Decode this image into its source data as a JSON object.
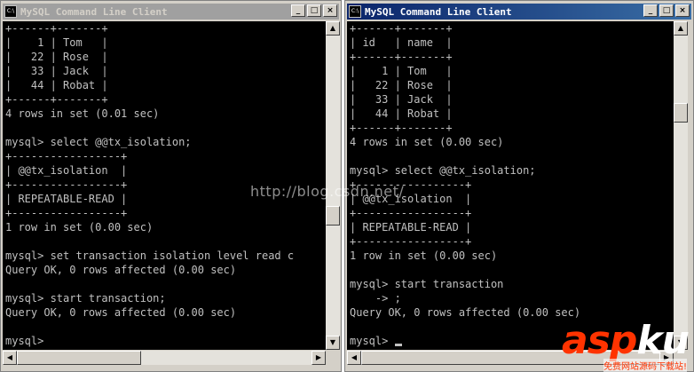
{
  "window_left": {
    "title": "MySQL Command Line Client",
    "console_lines": [
      "+------+-------+",
      "|    1 | Tom   |",
      "|   22 | Rose  |",
      "|   33 | Jack  |",
      "|   44 | Robat |",
      "+------+-------+",
      "4 rows in set (0.01 sec)",
      "",
      "mysql> select @@tx_isolation;",
      "+-----------------+",
      "| @@tx_isolation  |",
      "+-----------------+",
      "| REPEATABLE-READ |",
      "+-----------------+",
      "1 row in set (0.00 sec)",
      "",
      "mysql> set transaction isolation level read c",
      "Query OK, 0 rows affected (0.00 sec)",
      "",
      "mysql> start transaction;",
      "Query OK, 0 rows affected (0.00 sec)",
      "",
      "mysql>"
    ]
  },
  "window_right": {
    "title": "MySQL Command Line Client",
    "console_lines": [
      "+------+-------+",
      "| id   | name  |",
      "+------+-------+",
      "|    1 | Tom   |",
      "|   22 | Rose  |",
      "|   33 | Jack  |",
      "|   44 | Robat |",
      "+------+-------+",
      "4 rows in set (0.00 sec)",
      "",
      "mysql> select @@tx_isolation;",
      "+-----------------+",
      "| @@tx_isolation  |",
      "+-----------------+",
      "| REPEATABLE-READ |",
      "+-----------------+",
      "1 row in set (0.00 sec)",
      "",
      "mysql> start transaction",
      "    -> ;",
      "Query OK, 0 rows affected (0.00 sec)",
      "",
      "mysql> "
    ]
  },
  "title_buttons": {
    "minimize": "_",
    "maximize": "□",
    "close": "×"
  },
  "scroll_arrows": {
    "up": "▲",
    "down": "▼",
    "left": "◀",
    "right": "▶"
  },
  "icon_label": "C:\\",
  "watermark": "http://blog.csdn.net/",
  "logo": {
    "part1": "asp",
    "part2": "ku",
    "suffix": ".com",
    "tagline": "免费网站源码下载站!"
  },
  "colors": {
    "console_bg": "#000000",
    "console_text": "#c0c0c0",
    "title_active": "#0a246a",
    "title_inactive": "#a0a0a0",
    "logo_red": "#ff3300"
  }
}
